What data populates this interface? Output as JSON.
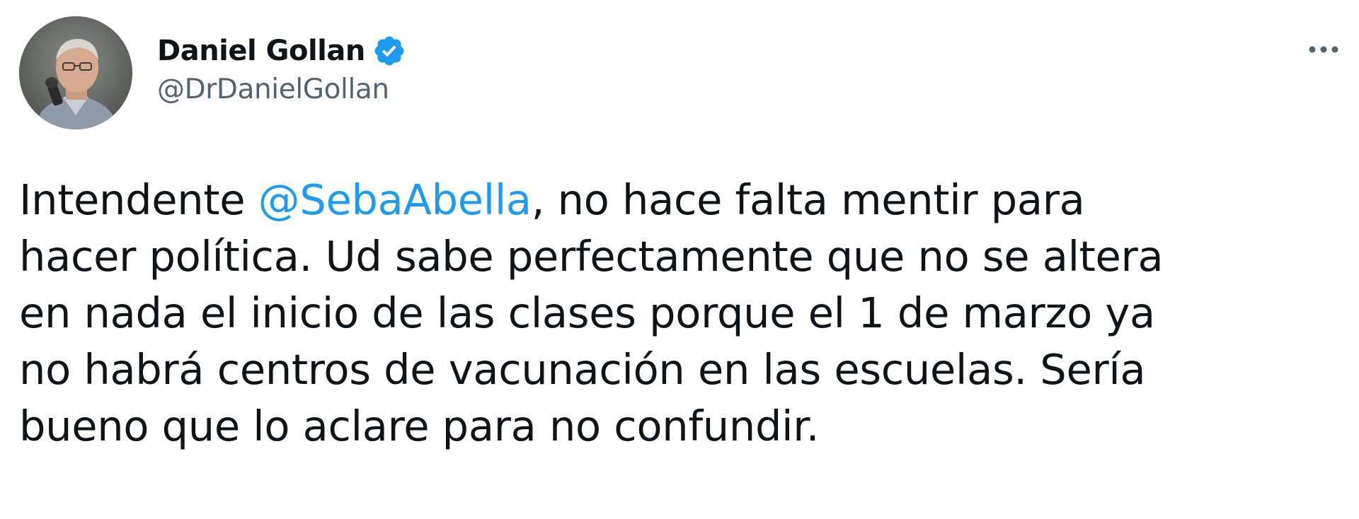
{
  "author": {
    "display_name": "Daniel Gollan",
    "handle": "@DrDanielGollan",
    "verified": true
  },
  "tweet": {
    "text_before_mention": "Intendente ",
    "mention": "@SebaAbella",
    "text_after_mention": ", no hace falta mentir para\nhacer política. Ud sabe perfectamente que no se altera\nen nada el inicio de las clases porque el 1 de marzo ya\nno habrá centros de vacunación en las escuelas. Sería\nbueno que lo aclare para no confundir."
  },
  "icons": {
    "verified": "verified-badge-icon",
    "more": "more-options-icon"
  },
  "colors": {
    "text": "#0f1419",
    "secondary": "#536471",
    "accent": "#1d9bf0"
  }
}
